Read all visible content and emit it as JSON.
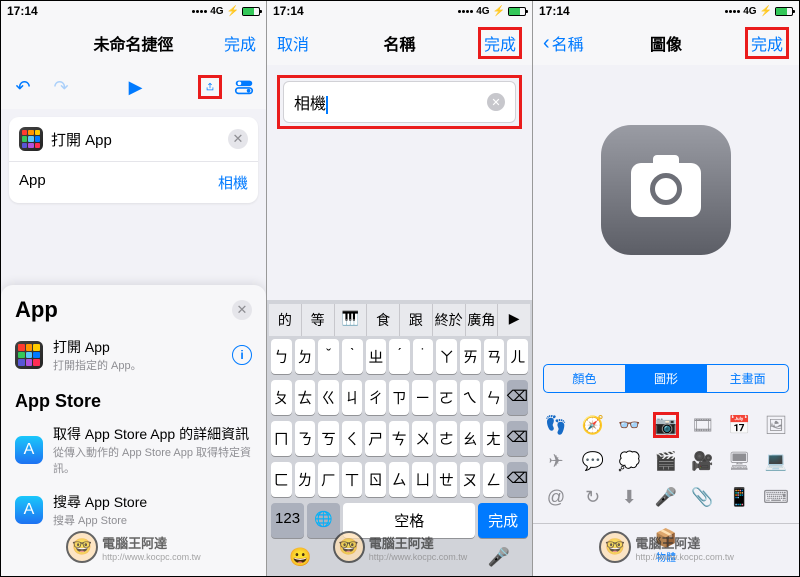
{
  "status": {
    "time": "17:14",
    "network": "4G"
  },
  "phone1": {
    "nav": {
      "title": "未命名捷徑",
      "done": "完成"
    },
    "card": {
      "title": "打開 App",
      "row_label": "App",
      "row_value": "相機"
    },
    "drawer": {
      "title": "App",
      "open_app": {
        "title": "打開 App",
        "sub": "打開指定的 App。"
      },
      "section": "App Store",
      "item1": {
        "title": "取得 App Store App 的詳細資訊",
        "sub": "從傳入動作的 App Store App 取得特定資訊。"
      },
      "item2": {
        "title": "搜尋 App Store",
        "sub": "搜尋 App Store"
      }
    }
  },
  "phone2": {
    "nav": {
      "cancel": "取消",
      "title": "名稱",
      "done": "完成"
    },
    "input_value": "相機",
    "suggestions": [
      "的",
      "等",
      "🎹",
      "食",
      "跟",
      "終於",
      "廣角",
      "▶"
    ],
    "kb_rows": [
      [
        "ㄅ",
        "ㄉ",
        "ˇ",
        "ˋ",
        "ㄓ",
        "ˊ",
        "˙",
        "ㄚ",
        "ㄞ",
        "ㄢ",
        "ㄦ"
      ],
      [
        "ㄆ",
        "ㄊ",
        "ㄍ",
        "ㄐ",
        "ㄔ",
        "ㄗ",
        "ㄧ",
        "ㄛ",
        "ㄟ",
        "ㄣ",
        ""
      ],
      [
        "ㄇ",
        "ㄋ",
        "ㄎ",
        "ㄑ",
        "ㄕ",
        "ㄘ",
        "ㄨ",
        "ㄜ",
        "ㄠ",
        "ㄤ",
        ""
      ],
      [
        "ㄈ",
        "ㄌ",
        "ㄏ",
        "ㄒ",
        "ㄖ",
        "ㄙ",
        "ㄩ",
        "ㄝ",
        "ㄡ",
        "ㄥ",
        ""
      ]
    ],
    "kb_bottom": {
      "num": "123",
      "space": "空格",
      "done": "完成"
    }
  },
  "phone3": {
    "nav": {
      "back": "名稱",
      "title": "圖像",
      "done": "完成"
    },
    "segments": [
      "顏色",
      "圖形",
      "主畫面"
    ],
    "tab_label": "物體"
  },
  "watermark": {
    "brand": "電腦王阿達",
    "url": "http://www.kocpc.com.tw"
  }
}
